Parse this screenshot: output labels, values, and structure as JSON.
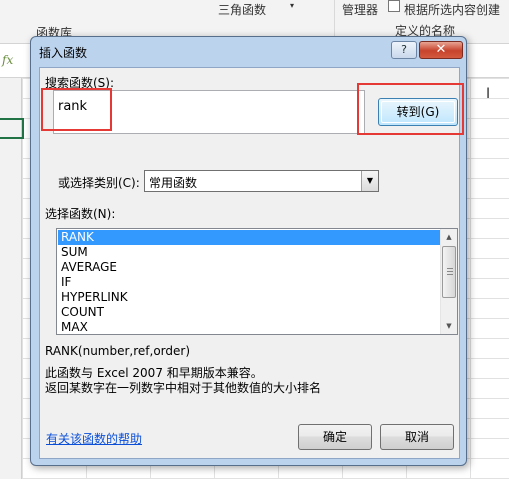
{
  "ribbon": {
    "group1": "函数库",
    "trig": "三角函数",
    "manager": "管理器",
    "create_from_sel": "根据所选内容创建",
    "defined_names": "定义的名称"
  },
  "formula_bar": {
    "fx": "fx"
  },
  "dialog": {
    "title": "插入函数",
    "help_btn": "?",
    "close_btn": "✕",
    "search_label": "搜索函数(S):",
    "search_value": "rank",
    "goto_button": "转到(G)",
    "category_label": "或选择类别(C):",
    "category_value": "常用函数",
    "function_list_label": "选择函数(N):",
    "functions": [
      "RANK",
      "SUM",
      "AVERAGE",
      "IF",
      "HYPERLINK",
      "COUNT",
      "MAX"
    ],
    "selected_function": "RANK",
    "syntax": "RANK(number,ref,order)",
    "desc_line1": "此函数与 Excel 2007 和早期版本兼容。",
    "desc_line2": "返回某数字在一列数字中相对于其他数值的大小排名",
    "help_link": "有关该函数的帮助",
    "ok_button": "确定",
    "cancel_button": "取消"
  },
  "colors": {
    "highlight_box": "#e53935",
    "selection": "#3399ff",
    "link": "#0b4fd8",
    "dialog_frame": "#bcd3ee"
  }
}
